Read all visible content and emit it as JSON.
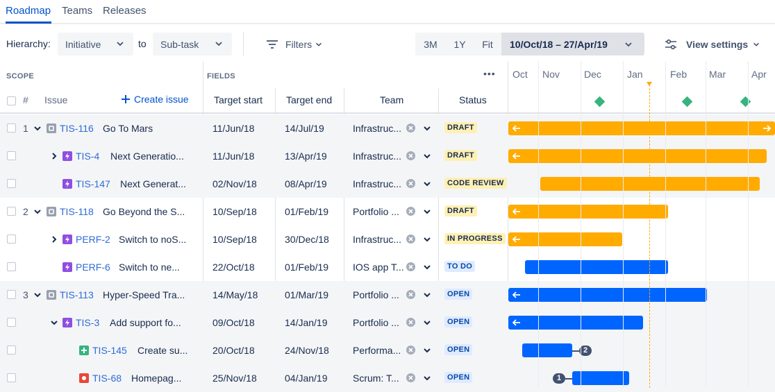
{
  "tabs": [
    {
      "label": "Roadmap",
      "active": true
    },
    {
      "label": "Teams",
      "active": false
    },
    {
      "label": "Releases",
      "active": false
    }
  ],
  "toolbar": {
    "hierarchy_label": "Hierarchy:",
    "hierarchy_from": "Initiative",
    "to_label": "to",
    "hierarchy_to": "Sub-task",
    "filters_label": "Filters",
    "ranges": [
      "3M",
      "1Y",
      "Fit"
    ],
    "date_range": "10/Oct/18 – 27/Apr/19",
    "view_settings_label": "View settings"
  },
  "grid": {
    "scope_label": "SCOPE",
    "fields_label": "FIELDS",
    "more_label": "•••",
    "hash_label": "#",
    "issue_label": "Issue",
    "create_issue_label": "Create issue",
    "columns": [
      "Target start",
      "Target end",
      "Team",
      "Status"
    ]
  },
  "timeline": {
    "months": [
      "Oct",
      "Nov",
      "Dec",
      "Jan",
      "Feb",
      "Mar",
      "Apr"
    ]
  },
  "colors": {
    "accent": "#0052cc",
    "bar_orange": "#ffab00",
    "bar_blue": "#0065ff",
    "milestone": "#36b37e",
    "today_line": "#ffab00",
    "icon_initiative": "#97a0af",
    "icon_epic": "#904ee2",
    "icon_story": "#36b37e",
    "icon_bug": "#e5493a"
  },
  "rows": [
    {
      "num": "1",
      "expand": "down",
      "type": "initiative",
      "key": "TIS-116",
      "summary": "Go To Mars",
      "start": "11/Jun/18",
      "end": "14/Jul/19",
      "team": "Infrastruc...",
      "status": "DRAFT",
      "status_color": "yellow",
      "bar_color": "orange"
    },
    {
      "num": "",
      "expand": "right",
      "type": "epic",
      "key": "TIS-4",
      "summary": "Next Generatio...",
      "start": "11/Jun/18",
      "end": "13/Apr/19",
      "team": "Infrastruc...",
      "status": "DRAFT",
      "status_color": "yellow",
      "bar_color": "orange"
    },
    {
      "num": "",
      "expand": "",
      "type": "epic",
      "key": "TIS-147",
      "summary": "Next Generat...",
      "start": "02/Nov/18",
      "end": "08/Apr/19",
      "team": "Infrastruc...",
      "status": "CODE REVIEW",
      "status_color": "yellow",
      "bar_color": "orange"
    },
    {
      "num": "2",
      "expand": "down",
      "type": "initiative",
      "key": "TIS-118",
      "summary": "Go Beyond the S...",
      "start": "10/Sep/18",
      "end": "01/Feb/19",
      "team": "Portfolio ...",
      "status": "DRAFT",
      "status_color": "yellow",
      "bar_color": "orange"
    },
    {
      "num": "",
      "expand": "right",
      "type": "epic",
      "key": "PERF-2",
      "summary": "Switch to noS...",
      "start": "10/Sep/18",
      "end": "30/Dec/18",
      "team": "Infrastruc...",
      "status": "IN PROGRESS",
      "status_color": "yellow",
      "bar_color": "orange"
    },
    {
      "num": "",
      "expand": "",
      "type": "epic",
      "key": "PERF-6",
      "summary": "Switch to ne...",
      "start": "22/Oct/18",
      "end": "01/Feb/19",
      "team": "IOS app T...",
      "status": "TO DO",
      "status_color": "blue",
      "bar_color": "blue"
    },
    {
      "num": "3",
      "expand": "down",
      "type": "initiative",
      "key": "TIS-113",
      "summary": "Hyper-Speed Tra...",
      "start": "14/May/18",
      "end": "01/Mar/19",
      "team": "Portfolio ...",
      "status": "OPEN",
      "status_color": "blue",
      "bar_color": "blue"
    },
    {
      "num": "",
      "expand": "down",
      "type": "epic",
      "key": "TIS-3",
      "summary": "Add support fo...",
      "start": "09/Oct/18",
      "end": "14/Jan/19",
      "team": "Portfolio ...",
      "status": "OPEN",
      "status_color": "blue",
      "bar_color": "blue"
    },
    {
      "num": "",
      "expand": "",
      "type": "story",
      "key": "TIS-145",
      "summary": "Create su...",
      "start": "20/Oct/18",
      "end": "24/Nov/18",
      "team": "Performa...",
      "status": "OPEN",
      "status_color": "blue",
      "bar_color": "blue",
      "dep_count": "2"
    },
    {
      "num": "",
      "expand": "",
      "type": "bug",
      "key": "TIS-68",
      "summary": "Homepag...",
      "start": "25/Nov/18",
      "end": "04/Jan/19",
      "team": "Scrum: T...",
      "status": "OPEN",
      "status_color": "blue",
      "bar_color": "blue",
      "dep_count": "1"
    }
  ]
}
